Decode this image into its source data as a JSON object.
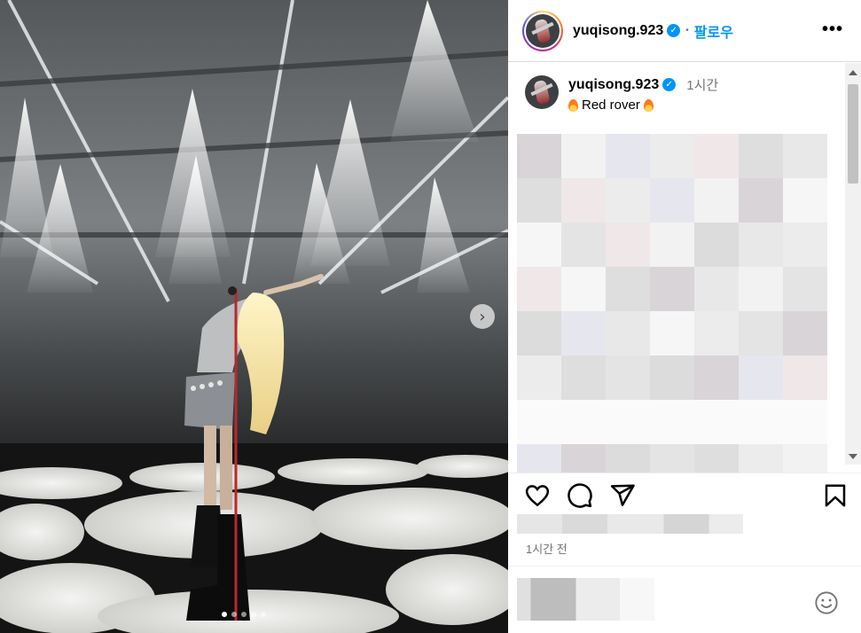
{
  "post": {
    "username": "yuqisong.923",
    "verified_mark": "✓",
    "separator": "•",
    "follow_label": "팔로우",
    "more_label": "•••",
    "caption_time": "1시간",
    "caption_text": "Red rover",
    "time_ago": "1시간 전"
  },
  "media": {
    "next_arrow": "›",
    "carousel_dots": 5,
    "active_dot": 0
  },
  "icons": {
    "like": "heart-icon",
    "comment": "comment-icon",
    "share": "send-icon",
    "save": "bookmark-icon",
    "emoji": "smiley-icon",
    "caption_emoji": "fire-icon"
  },
  "colors": {
    "accent": "#0095f6",
    "muted": "#737373",
    "border": "#dbdbdb"
  }
}
